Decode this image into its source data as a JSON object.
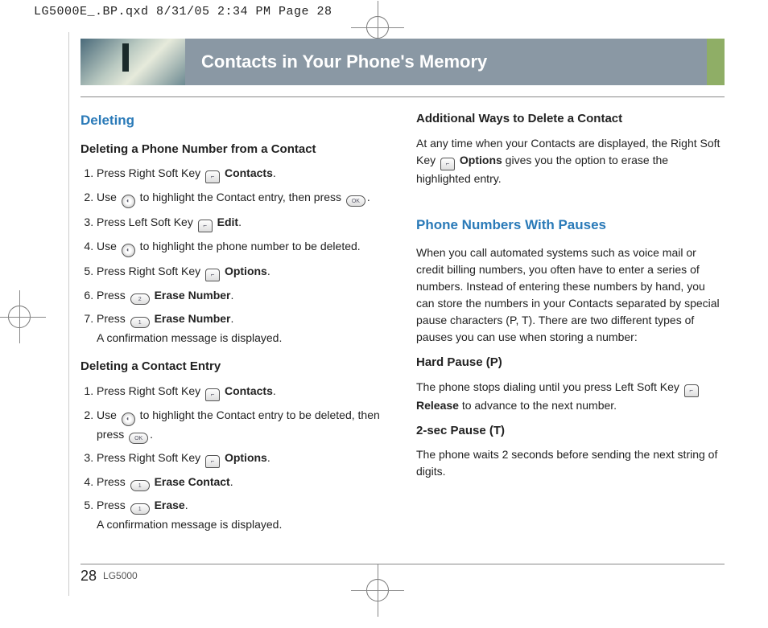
{
  "print_header": "LG5000E_.BP.qxd  8/31/05  2:34 PM  Page 28",
  "header_title": "Contacts in Your Phone's Memory",
  "footer": {
    "page": "28",
    "model": "LG5000"
  },
  "left": {
    "h2": "Deleting",
    "sec1_h3": "Deleting a Phone Number from a Contact",
    "sec1": {
      "s1a": "Press Right Soft Key ",
      "s1b": "Contacts",
      "s1c": ".",
      "s2a": "Use ",
      "s2b": " to highlight the Contact entry, then press ",
      "s2c": ".",
      "s3a": "Press Left Soft Key ",
      "s3b": "Edit",
      "s3c": ".",
      "s4a": "Use ",
      "s4b": " to highlight the phone number to be deleted.",
      "s5a": "Press Right Soft Key ",
      "s5b": "Options",
      "s5c": ".",
      "s6a": "Press ",
      "s6b": "Erase Number",
      "s6c": ".",
      "s7a": "Press ",
      "s7b": "Erase Number",
      "s7c": ".",
      "s7_note": "A confirmation message is displayed."
    },
    "sec2_h3": "Deleting a Contact Entry",
    "sec2": {
      "s1a": "Press Right Soft Key ",
      "s1b": "Contacts",
      "s1c": ".",
      "s2a": "Use ",
      "s2b": " to highlight the Contact entry to be deleted, then press ",
      "s2c": ".",
      "s3a": "Press Right Soft Key ",
      "s3b": "Options",
      "s3c": ".",
      "s4a": "Press ",
      "s4b": "Erase Contact",
      "s4c": ".",
      "s5a": "Press ",
      "s5b": "Erase",
      "s5c": ".",
      "s5_note": "A confirmation message is displayed."
    }
  },
  "right": {
    "sec1_h3": "Additional Ways to Delete a Contact",
    "p1a": "At any time when your Contacts are displayed, the Right Soft Key ",
    "p1b": "Options",
    "p1c": " gives you the option to erase the highlighted entry.",
    "h2": "Phone Numbers With Pauses",
    "p2": "When you call automated systems such as voice mail or credit billing numbers, you often have to enter a series of numbers. Instead of entering these numbers by hand, you can store the numbers in your Contacts separated by special pause characters (P, T). There are two different types of pauses you can use when storing a number:",
    "hard_h": "Hard Pause (P)",
    "hard_a": "The phone stops dialing until you press Left Soft Key ",
    "hard_b": "Release",
    "hard_c": " to advance to the next number.",
    "t2_h": "2-sec Pause (T)",
    "t2_p": "The phone waits 2 seconds before sending the next string of digits."
  },
  "keys": {
    "two": "2",
    "one": "1",
    "ok": "OK"
  }
}
